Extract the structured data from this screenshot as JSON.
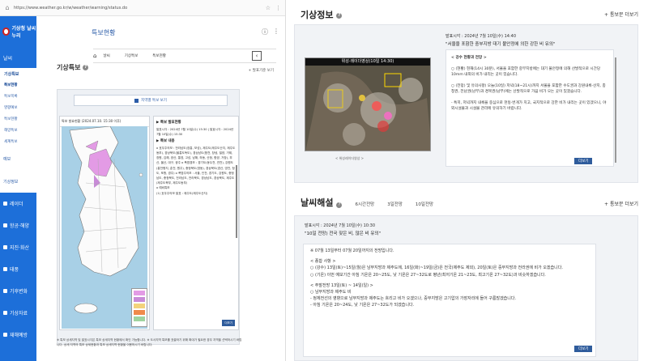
{
  "browser": {
    "url": "https://www.weather.go.kr/w/weather/warning/status.do"
  },
  "sidenav": {
    "logo": "기상청 날씨누리",
    "top_items": [
      "날씨",
      "기상특보"
    ],
    "sub_items": [
      "특보현황",
      "특보현황",
      "특보목록",
      "영향예보",
      "특보현황",
      "해양특보",
      "세계특보"
    ],
    "white_items": [
      "예보",
      "기상정보"
    ],
    "lower_items": [
      "레이더",
      "항공·해양",
      "지진·화산",
      "태풍",
      "기후변화",
      "기상자료",
      "재해예방",
      "날씨"
    ]
  },
  "left": {
    "page_title": "특보현황",
    "breadcrumb": [
      "날씨",
      "기상특보",
      "특보현황"
    ],
    "section_title": "기상특보",
    "section_more": "+ 발표기준 보기",
    "map_button": "지역별 특보 보기",
    "map_title": "특보 발효현황 (2024.07.10. 15:30 이후)",
    "text_heading1": "▶ 특보 발표현황",
    "text_line1": "발표시각 : 2024년 7월 10일(수) 15:30 | 발효시각 : 2024년 7월 10일(수) 15:30",
    "text_heading2": "▶ 특보 내용",
    "text_body": "o 호우주의보 : 전라남도(장흥, 보성), 제주도(제주도산지, 제주도동부), 경상북도(울릉도독도), 경상남도(합천, 창녕, 밀양, 거제, 창원, 김해, 양산, 통영, 고성, 남해, 하동, 산청, 함양, 거창), 부산, 울산, 대구, 광주 o 폭염경보 : 경기도(동두천, 연천), 강원도(홍천평지, 춘천, 원주), 충청북도(영동), 경상북도(경산, 영천, 청도, 포항, 경주) o 폭염주의보 : 서울, 인천, 경기도, 강원도, 충청남도, 충청북도, 전라남도, 전라북도, 경상남도, 경상북도, 제주도(제주도북부, 제주도동부)",
    "text_footer1": "o 예비특보",
    "text_footer2": "(1) 호우주의보 발표 : 제주도(제주도산지)",
    "more_label": "더보기",
    "note": "※ 특보 상세지역 및 발표시각은 특보 상세지역 현황에서 확인 가능합니다. ※ 도서지역 특보를 표출하기 위해 확대가 필요한 경우 지역을 선택하시기 바랍니다. 상세 지역의 특보 상세현황과 특보 상세지역 현황을 이용하시기 바랍니다."
  },
  "right": {
    "info_title": "기상정보",
    "info_more": "+ 통보문 더보기",
    "sat_title": "위성·레이더영상(10일 14:30)",
    "sat_caption": "< 위성레이더영상 >",
    "info_time": "발표시각 : 2024년 7월 10일(수) 14:40",
    "info_quote": "\"서울을 포함한 중부지방 대기 불안정에 의한 강한 비 유의\"",
    "info_h1": "< 강수 현황과 전망 >",
    "info_p1": "○ (현황) 현재(14시 30분), 서울을 포함한 중부지방에는 대기 불안정에 의해 산발적으로 시간당 10mm 내외의 비가 내리는 곳이 있습니다.",
    "info_p2": "○ (전망) 및 유의사항) 오늘(10일) 저녁(18~21시)까지 서울을 포함한 수도권과 강원내륙·산지, 충청권, 전남권(남부)과 경북권(남부)에는 산발적으로 가끔 비가 오는 곳이 있겠습니다.",
    "info_p3": "- 특히, 저녁까지 내륙을 중심으로 천둥·번개가 치고, 국지적으로 강한 비가 내리는 곳이 있겠으니, 야외시설물과 시설물 관리에 유의하기 바랍니다.",
    "more_label": "더보기",
    "tabs": [
      "날씨해설",
      "6시간전망",
      "3일전망",
      "10일전망"
    ],
    "fc_more": "+ 통보문 더보기",
    "fc_time": "발표시각 : 2024년 7월 10일(수) 10:30",
    "fc_quote": "\"10일 전망) 전국 잦은 비, 많은 비 유의\"",
    "fc_l1": "※ 07월 13일부터 07월 20일까지의 전망입니다.",
    "fc_h1": "< 종합 사항 >",
    "fc_l2": "○ (강수) 13일(토)~15일(월)은 남부지방과 제주도에, 16일(화)~19일(금)은 전국(제주도 제외), 20일(토)은 중부지방과 전라권에 비가 오겠습니다.",
    "fc_l3": "○ (기온) 이번 예보기간 아침 기온은 20~25도, 낮 기온은 27~32도로 평년(최저기온 21~23도, 최고기온 27~32도)과 비슷하겠습니다.",
    "fc_h2": "< 주말전망 13일(토) ~ 14일(일) >",
    "fc_l4": "○ 남부지방과 제주도 비",
    "fc_l5": "- 정체전선의 영향으로 남부지방과 제주도는 흐리고 비가 오겠으나, 중부지방은 고기압의 가장자리에 들어 구름많겠습니다.",
    "fc_l6": "- 아침 기온은 20~24도, 낮 기온은 27~32도가 되겠습니다."
  }
}
